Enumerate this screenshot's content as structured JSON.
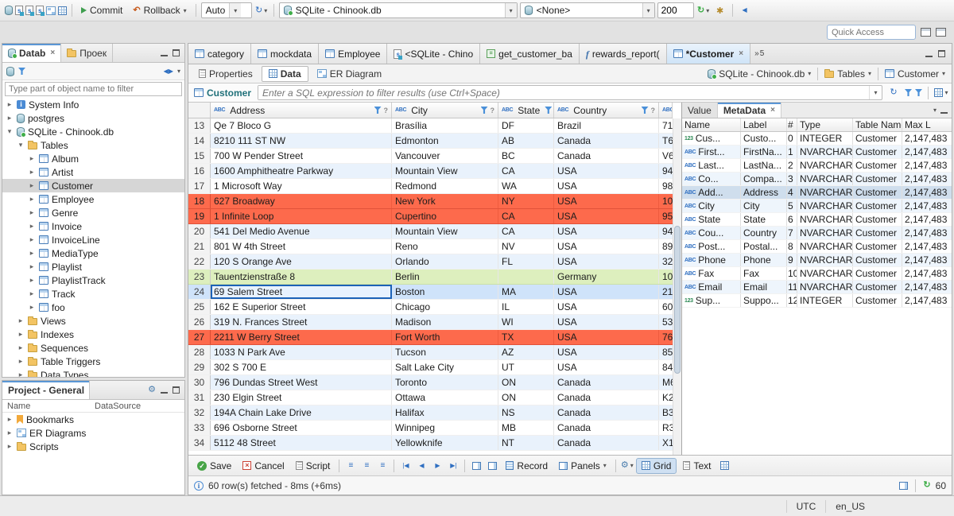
{
  "window": {
    "status_right": [
      "UTC",
      "en_US"
    ]
  },
  "toolbar": {
    "commit": "Commit",
    "rollback": "Rollback",
    "auto": "Auto",
    "connection": "SQLite - Chinook.db",
    "schema": "<None>",
    "fetch_size": "200",
    "quick_access_placeholder": "Quick Access"
  },
  "navigator": {
    "tabs": [
      {
        "label": "Datab",
        "active": true
      },
      {
        "label": "Проек",
        "active": false
      }
    ],
    "filter_placeholder": "Type part of object name to filter",
    "tree": [
      {
        "label": "System Info",
        "depth": 0,
        "icon": "info",
        "expander": "collapsed"
      },
      {
        "label": "postgres",
        "depth": 0,
        "icon": "db",
        "expander": "collapsed"
      },
      {
        "label": "SQLite - Chinook.db",
        "depth": 0,
        "icon": "db-on",
        "expander": "expanded"
      },
      {
        "label": "Tables",
        "depth": 1,
        "icon": "folder",
        "expander": "expanded"
      },
      {
        "label": "Album",
        "depth": 2,
        "icon": "table",
        "expander": "collapsed"
      },
      {
        "label": "Artist",
        "depth": 2,
        "icon": "table",
        "expander": "collapsed"
      },
      {
        "label": "Customer",
        "depth": 2,
        "icon": "table",
        "expander": "collapsed",
        "selected": true
      },
      {
        "label": "Employee",
        "depth": 2,
        "icon": "table",
        "expander": "collapsed"
      },
      {
        "label": "Genre",
        "depth": 2,
        "icon": "table",
        "expander": "collapsed"
      },
      {
        "label": "Invoice",
        "depth": 2,
        "icon": "table",
        "expander": "collapsed"
      },
      {
        "label": "InvoiceLine",
        "depth": 2,
        "icon": "table",
        "expander": "collapsed"
      },
      {
        "label": "MediaType",
        "depth": 2,
        "icon": "table",
        "expander": "collapsed"
      },
      {
        "label": "Playlist",
        "depth": 2,
        "icon": "table",
        "expander": "collapsed"
      },
      {
        "label": "PlaylistTrack",
        "depth": 2,
        "icon": "table",
        "expander": "collapsed"
      },
      {
        "label": "Track",
        "depth": 2,
        "icon": "table",
        "expander": "collapsed"
      },
      {
        "label": "foo",
        "depth": 2,
        "icon": "table",
        "expander": "collapsed"
      },
      {
        "label": "Views",
        "depth": 1,
        "icon": "folder",
        "expander": "collapsed"
      },
      {
        "label": "Indexes",
        "depth": 1,
        "icon": "folder",
        "expander": "collapsed"
      },
      {
        "label": "Sequences",
        "depth": 1,
        "icon": "folder",
        "expander": "collapsed"
      },
      {
        "label": "Table Triggers",
        "depth": 1,
        "icon": "folder",
        "expander": "collapsed"
      },
      {
        "label": "Data Types",
        "depth": 1,
        "icon": "folder",
        "expander": "collapsed"
      }
    ]
  },
  "project_panel": {
    "tab": "Project - General",
    "columns": [
      "Name",
      "DataSource"
    ],
    "items": [
      {
        "label": "Bookmarks",
        "icon": "bookmark"
      },
      {
        "label": "ER Diagrams",
        "icon": "erd"
      },
      {
        "label": "Scripts",
        "icon": "folder"
      }
    ]
  },
  "editor_tabs": [
    {
      "label": "category",
      "icon": "table"
    },
    {
      "label": "mockdata",
      "icon": "table"
    },
    {
      "label": "Employee",
      "icon": "table"
    },
    {
      "label": "<SQLite - Chino",
      "icon": "sql"
    },
    {
      "label": "get_customer_ba",
      "icon": "proc"
    },
    {
      "label": "rewards_report(",
      "icon": "func"
    },
    {
      "label": "*Customer",
      "icon": "table",
      "active": true,
      "closable": true
    }
  ],
  "editor_tabs_overflow": "5",
  "result_tabs": [
    {
      "label": "Properties",
      "icon": "page"
    },
    {
      "label": "Data",
      "icon": "grid",
      "active": true
    },
    {
      "label": "ER Diagram",
      "icon": "erd"
    }
  ],
  "breadcrumb": [
    {
      "label": "SQLite - Chinook.db",
      "icon": "db-on"
    },
    {
      "label": "Tables",
      "icon": "folder"
    },
    {
      "label": "Customer",
      "icon": "table"
    }
  ],
  "filter_bar": {
    "table": "Customer",
    "placeholder": "Enter a SQL expression to filter results (use Ctrl+Space)"
  },
  "grid": {
    "columns": [
      {
        "label": "Address",
        "type": "ABC"
      },
      {
        "label": "City",
        "type": "ABC"
      },
      {
        "label": "State",
        "type": "ABC"
      },
      {
        "label": "Country",
        "type": "ABC"
      },
      {
        "label": "",
        "type": "ABC"
      }
    ],
    "rows": [
      {
        "num": "13",
        "cells": [
          "Qe 7 Bloco G",
          "Brasília",
          "DF",
          "Brazil",
          "71"
        ]
      },
      {
        "num": "14",
        "cells": [
          "8210 111 ST NW",
          "Edmonton",
          "AB",
          "Canada",
          "T6"
        ]
      },
      {
        "num": "15",
        "cells": [
          "700 W Pender Street",
          "Vancouver",
          "BC",
          "Canada",
          "V6"
        ]
      },
      {
        "num": "16",
        "cells": [
          "1600 Amphitheatre Parkway",
          "Mountain View",
          "CA",
          "USA",
          "94"
        ]
      },
      {
        "num": "17",
        "cells": [
          "1 Microsoft Way",
          "Redmond",
          "WA",
          "USA",
          "98"
        ]
      },
      {
        "num": "18",
        "cells": [
          "627 Broadway",
          "New York",
          "NY",
          "USA",
          "10"
        ],
        "state": "error"
      },
      {
        "num": "19",
        "cells": [
          "1 Infinite Loop",
          "Cupertino",
          "CA",
          "USA",
          "95"
        ],
        "state": "error"
      },
      {
        "num": "20",
        "cells": [
          "541 Del Medio Avenue",
          "Mountain View",
          "CA",
          "USA",
          "94"
        ]
      },
      {
        "num": "21",
        "cells": [
          "801 W 4th Street",
          "Reno",
          "NV",
          "USA",
          "89"
        ]
      },
      {
        "num": "22",
        "cells": [
          "120 S Orange Ave",
          "Orlando",
          "FL",
          "USA",
          "32"
        ]
      },
      {
        "num": "23",
        "cells": [
          "Tauentzienstraße 8",
          "Berlin",
          "",
          "Germany",
          "10"
        ],
        "state": "new"
      },
      {
        "num": "24",
        "cells": [
          "69 Salem Street",
          "Boston",
          "MA",
          "USA",
          "21"
        ],
        "state": "selected"
      },
      {
        "num": "25",
        "cells": [
          "162 E Superior Street",
          "Chicago",
          "IL",
          "USA",
          "60"
        ]
      },
      {
        "num": "26",
        "cells": [
          "319 N. Frances Street",
          "Madison",
          "WI",
          "USA",
          "53"
        ]
      },
      {
        "num": "27",
        "cells": [
          "2211 W Berry Street",
          "Fort Worth",
          "TX",
          "USA",
          "76"
        ],
        "state": "error"
      },
      {
        "num": "28",
        "cells": [
          "1033 N Park Ave",
          "Tucson",
          "AZ",
          "USA",
          "85"
        ]
      },
      {
        "num": "29",
        "cells": [
          "302 S 700 E",
          "Salt Lake City",
          "UT",
          "USA",
          "84"
        ]
      },
      {
        "num": "30",
        "cells": [
          "796 Dundas Street West",
          "Toronto",
          "ON",
          "Canada",
          "M6"
        ]
      },
      {
        "num": "31",
        "cells": [
          "230 Elgin Street",
          "Ottawa",
          "ON",
          "Canada",
          "K2"
        ]
      },
      {
        "num": "32",
        "cells": [
          "194A Chain Lake Drive",
          "Halifax",
          "NS",
          "Canada",
          "B3"
        ]
      },
      {
        "num": "33",
        "cells": [
          "696 Osborne Street",
          "Winnipeg",
          "MB",
          "Canada",
          "R3"
        ]
      },
      {
        "num": "34",
        "cells": [
          "5112 48 Street",
          "Yellowknife",
          "NT",
          "Canada",
          "X1"
        ]
      }
    ]
  },
  "value_panel": {
    "tabs": [
      {
        "label": "Value"
      },
      {
        "label": "MetaData",
        "active": true,
        "closable": true
      }
    ],
    "columns": [
      "Name",
      "Label",
      "#",
      "Type",
      "Table Name",
      "Max L"
    ],
    "rows": [
      {
        "tag": "123",
        "name": "Cus...",
        "label": "Custo...",
        "ord": "0",
        "datatype": "INTEGER",
        "table": "Customer",
        "maxlen": "2,147,483"
      },
      {
        "tag": "ABC",
        "name": "First...",
        "label": "FirstNa...",
        "ord": "1",
        "datatype": "NVARCHAR",
        "table": "Customer",
        "maxlen": "2,147,483"
      },
      {
        "tag": "ABC",
        "name": "Last...",
        "label": "LastNa...",
        "ord": "2",
        "datatype": "NVARCHAR",
        "table": "Customer",
        "maxlen": "2,147,483"
      },
      {
        "tag": "ABC",
        "name": "Co...",
        "label": "Compa...",
        "ord": "3",
        "datatype": "NVARCHAR",
        "table": "Customer",
        "maxlen": "2,147,483"
      },
      {
        "tag": "ABC",
        "name": "Add...",
        "label": "Address",
        "ord": "4",
        "datatype": "NVARCHAR",
        "table": "Customer",
        "maxlen": "2,147,483",
        "selected": true
      },
      {
        "tag": "ABC",
        "name": "City",
        "label": "City",
        "ord": "5",
        "datatype": "NVARCHAR",
        "table": "Customer",
        "maxlen": "2,147,483"
      },
      {
        "tag": "ABC",
        "name": "State",
        "label": "State",
        "ord": "6",
        "datatype": "NVARCHAR",
        "table": "Customer",
        "maxlen": "2,147,483"
      },
      {
        "tag": "ABC",
        "name": "Cou...",
        "label": "Country",
        "ord": "7",
        "datatype": "NVARCHAR",
        "table": "Customer",
        "maxlen": "2,147,483"
      },
      {
        "tag": "ABC",
        "name": "Post...",
        "label": "Postal...",
        "ord": "8",
        "datatype": "NVARCHAR",
        "table": "Customer",
        "maxlen": "2,147,483"
      },
      {
        "tag": "ABC",
        "name": "Phone",
        "label": "Phone",
        "ord": "9",
        "datatype": "NVARCHAR",
        "table": "Customer",
        "maxlen": "2,147,483"
      },
      {
        "tag": "ABC",
        "name": "Fax",
        "label": "Fax",
        "ord": "10",
        "datatype": "NVARCHAR",
        "table": "Customer",
        "maxlen": "2,147,483"
      },
      {
        "tag": "ABC",
        "name": "Email",
        "label": "Email",
        "ord": "11",
        "datatype": "NVARCHAR",
        "table": "Customer",
        "maxlen": "2,147,483"
      },
      {
        "tag": "123",
        "name": "Sup...",
        "label": "Suppo...",
        "ord": "12",
        "datatype": "INTEGER",
        "table": "Customer",
        "maxlen": "2,147,483"
      }
    ]
  },
  "grid_toolbar": {
    "save": "Save",
    "cancel": "Cancel",
    "script": "Script",
    "record": "Record",
    "panels": "Panels",
    "grid": "Grid",
    "text": "Text"
  },
  "status": {
    "fetched": "60 row(s) fetched - 8ms (+6ms)",
    "row_count": "60"
  }
}
